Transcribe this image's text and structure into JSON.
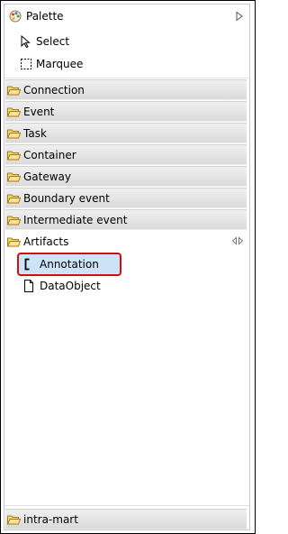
{
  "palette": {
    "title": "Palette",
    "tools": [
      {
        "label": "Select",
        "icon": "arrow-cursor-icon"
      },
      {
        "label": "Marquee",
        "icon": "marquee-icon"
      }
    ],
    "drawers": [
      {
        "label": "Connection",
        "state": "collapsed"
      },
      {
        "label": "Event",
        "state": "collapsed"
      },
      {
        "label": "Task",
        "state": "collapsed"
      },
      {
        "label": "Container",
        "state": "collapsed"
      },
      {
        "label": "Gateway",
        "state": "collapsed"
      },
      {
        "label": "Boundary event",
        "state": "collapsed"
      },
      {
        "label": "Intermediate event",
        "state": "collapsed"
      }
    ],
    "artifacts": {
      "label": "Artifacts",
      "state": "expanded",
      "entries": [
        {
          "label": "Annotation",
          "icon": "annotation-icon",
          "selected": true
        },
        {
          "label": "DataObject",
          "icon": "data-object-icon",
          "selected": false
        }
      ]
    },
    "bottom_drawer": {
      "label": "intra-mart",
      "state": "collapsed"
    }
  },
  "colors": {
    "selection_fill": "#cde3f8",
    "selection_border": "#d01010",
    "folder_fill": "#f7d774"
  }
}
